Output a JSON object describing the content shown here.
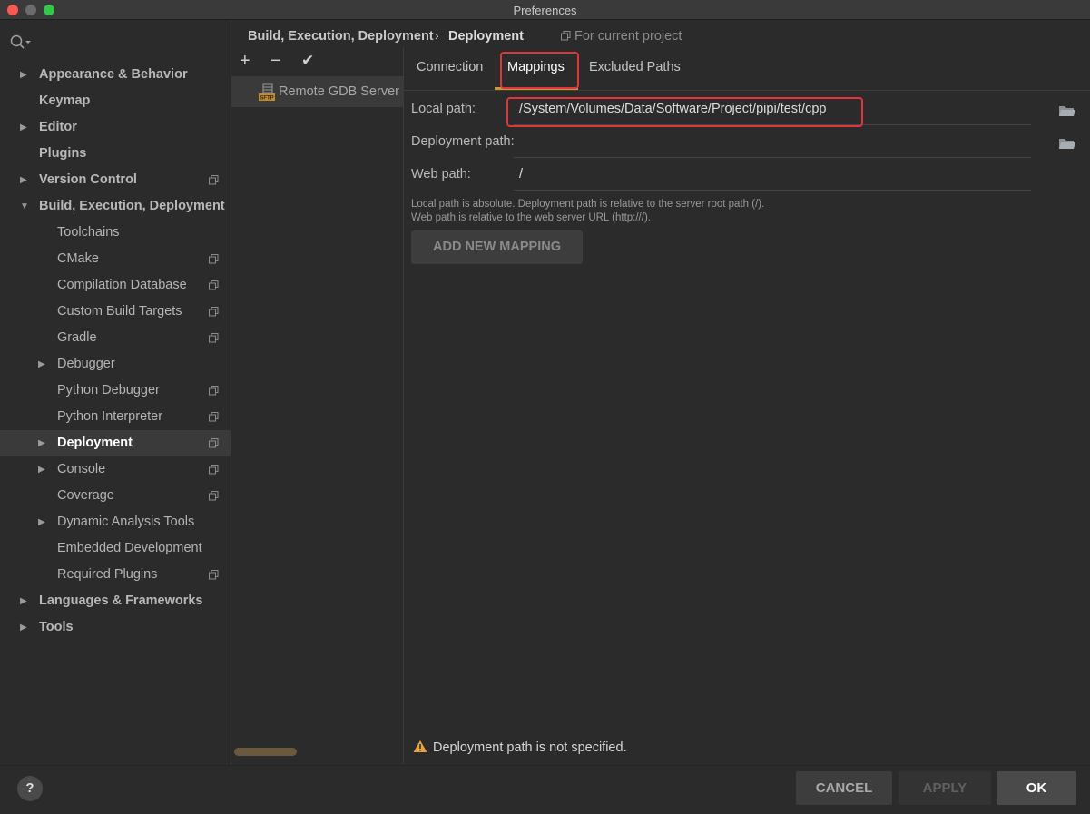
{
  "window": {
    "title": "Preferences"
  },
  "sidebar": {
    "items": [
      {
        "label": "Appearance & Behavior",
        "arrow": "▶",
        "level": 1
      },
      {
        "label": "Keymap",
        "arrow": "",
        "level": 1
      },
      {
        "label": "Editor",
        "arrow": "▶",
        "level": 1
      },
      {
        "label": "Plugins",
        "arrow": "",
        "level": 1
      },
      {
        "label": "Version Control",
        "arrow": "▶",
        "level": 1,
        "project": true
      },
      {
        "label": "Build, Execution, Deployment",
        "arrow": "▼",
        "level": 1
      },
      {
        "label": "Toolchains",
        "arrow": "",
        "level": 2
      },
      {
        "label": "CMake",
        "arrow": "",
        "level": 2,
        "project": true
      },
      {
        "label": "Compilation Database",
        "arrow": "",
        "level": 2,
        "project": true
      },
      {
        "label": "Custom Build Targets",
        "arrow": "",
        "level": 2,
        "project": true
      },
      {
        "label": "Gradle",
        "arrow": "",
        "level": 2,
        "project": true
      },
      {
        "label": "Debugger",
        "arrow": "▶",
        "level": 2
      },
      {
        "label": "Python Debugger",
        "arrow": "",
        "level": 2,
        "project": true
      },
      {
        "label": "Python Interpreter",
        "arrow": "",
        "level": 2,
        "project": true
      },
      {
        "label": "Deployment",
        "arrow": "▶",
        "level": 2,
        "project": true,
        "selected": true
      },
      {
        "label": "Console",
        "arrow": "▶",
        "level": 2,
        "project": true
      },
      {
        "label": "Coverage",
        "arrow": "",
        "level": 2,
        "project": true
      },
      {
        "label": "Dynamic Analysis Tools",
        "arrow": "▶",
        "level": 2
      },
      {
        "label": "Embedded Development",
        "arrow": "",
        "level": 2
      },
      {
        "label": "Required Plugins",
        "arrow": "",
        "level": 2,
        "project": true
      },
      {
        "label": "Languages & Frameworks",
        "arrow": "▶",
        "level": 1
      },
      {
        "label": "Tools",
        "arrow": "▶",
        "level": 1
      }
    ]
  },
  "header": {
    "crumb1": "Build, Execution, Deployment",
    "separator": "›",
    "crumb2": "Deployment",
    "scope": "For current project"
  },
  "servers": {
    "add": "+",
    "remove": "−",
    "default": "✔",
    "items": [
      {
        "label": "Remote GDB Server (C",
        "icon": "sftp-icon"
      }
    ]
  },
  "tabs": [
    {
      "label": "Connection"
    },
    {
      "label": "Mappings",
      "active": true
    },
    {
      "label": "Excluded Paths"
    }
  ],
  "mappings": {
    "local_label": "Local path:",
    "local_value": "/System/Volumes/Data/Software/Project/pipi/test/cpp",
    "deploy_label": "Deployment path:",
    "deploy_value": "",
    "web_label": "Web path:",
    "web_value": "/",
    "hint1": "Local path is absolute. Deployment path is relative to the server root path (/).",
    "hint2": "Web path is relative to the web server URL (http:///).",
    "add_button": "ADD NEW MAPPING"
  },
  "warning": "Deployment path is not specified.",
  "footer": {
    "help": "?",
    "cancel": "CANCEL",
    "apply": "APPLY",
    "ok": "OK"
  },
  "colors": {
    "background": "#2b2b2b",
    "highlight": "#e2343b",
    "tab_underline": "#c89b32",
    "warning": "#e8a33c"
  }
}
